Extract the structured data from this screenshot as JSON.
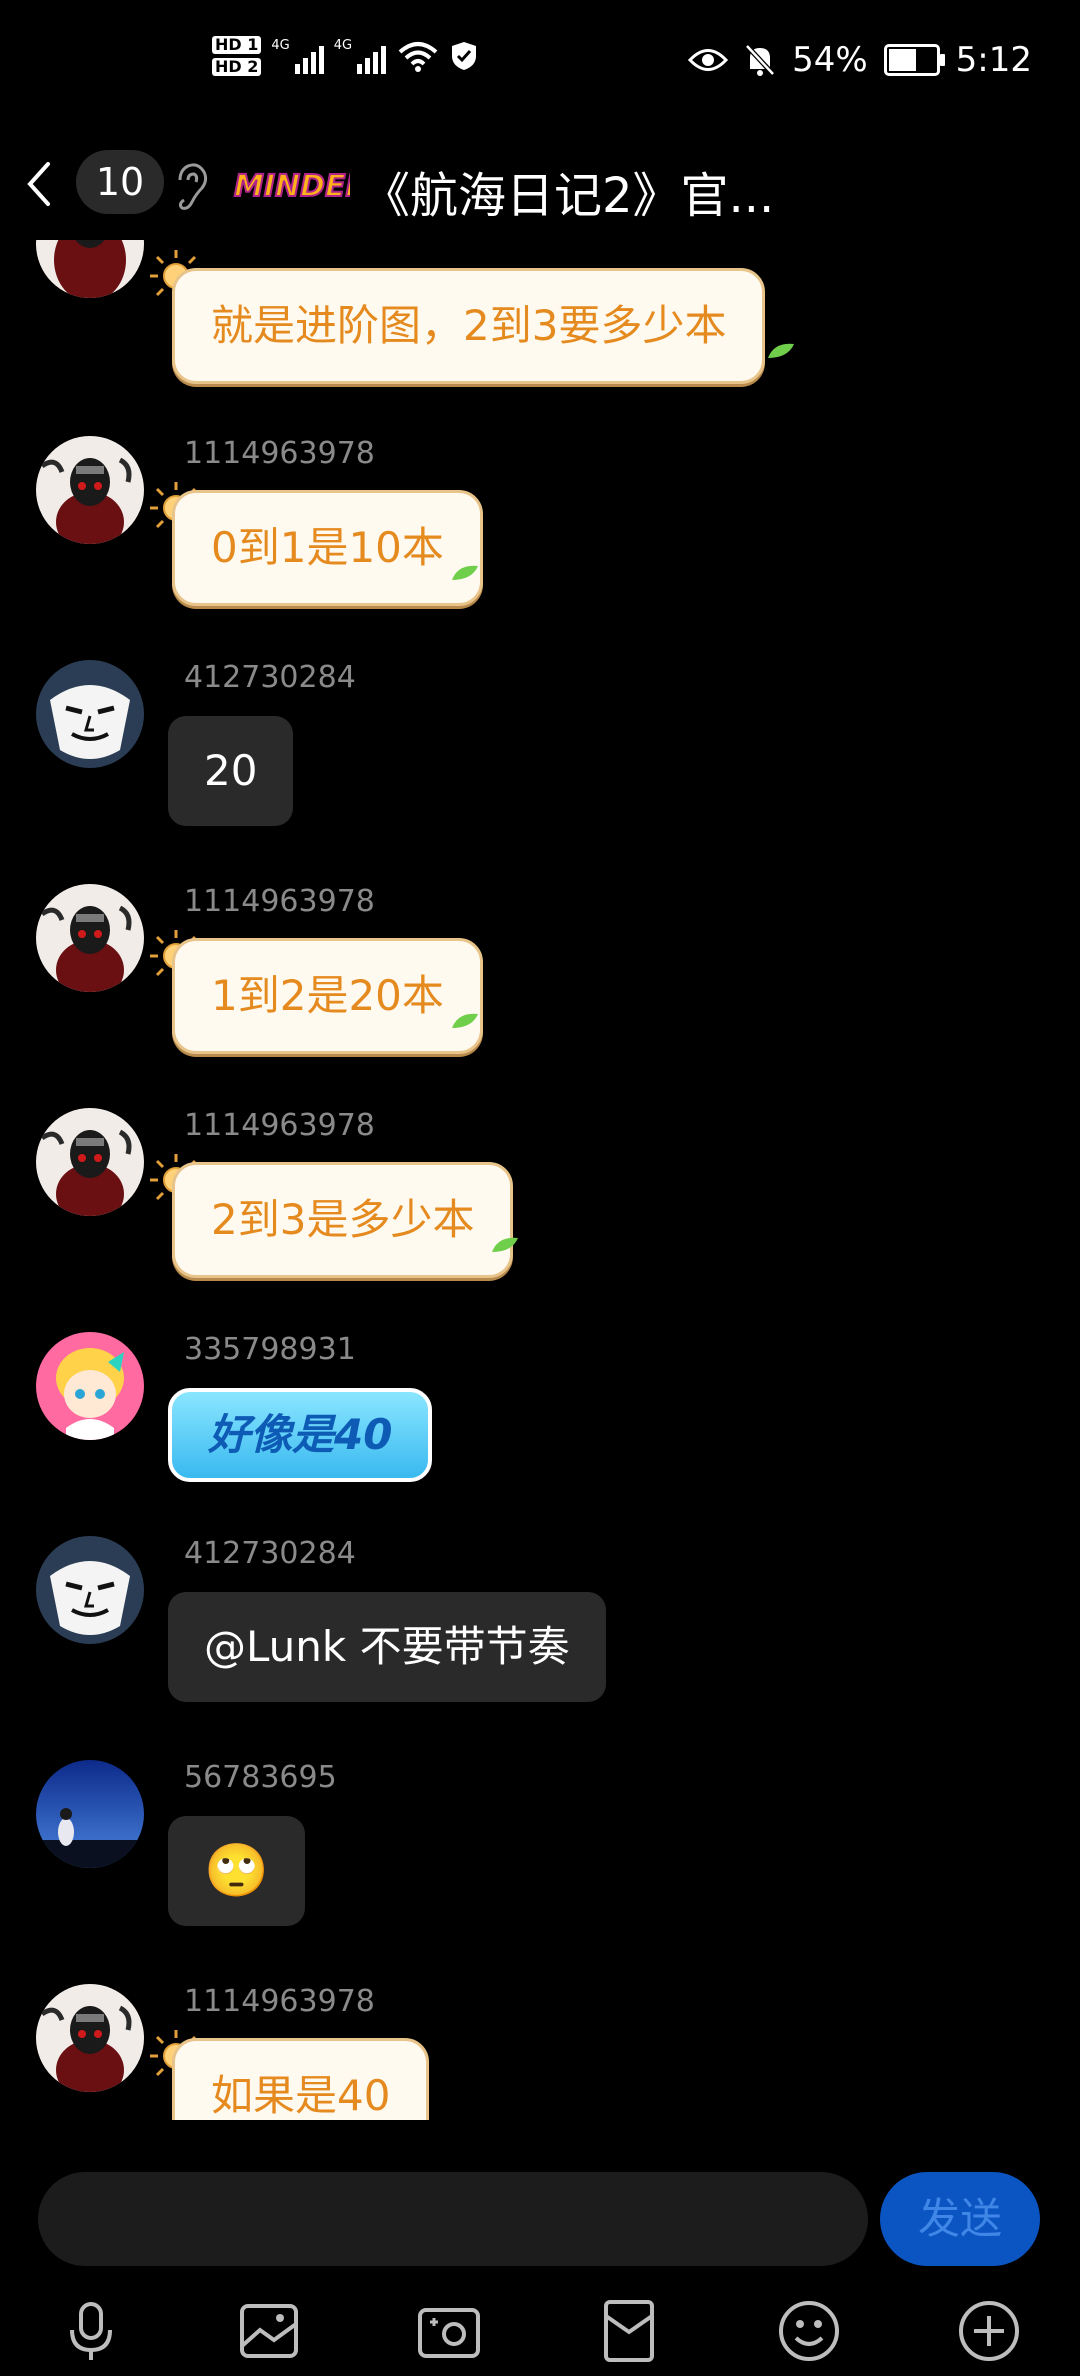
{
  "status_bar": {
    "hd1": "HD 1",
    "hd2": "HD 2",
    "net1": "4G",
    "net2": "4G",
    "wifi_gen": "6",
    "battery": "54%",
    "time": "5:12"
  },
  "header": {
    "unread_count": "10",
    "logo_text": "MINDED",
    "title": "《航海日记2》官..."
  },
  "messages": [
    {
      "sender": "",
      "text": "就是进阶图，2到3要多少本",
      "style": "cream"
    },
    {
      "sender": "1114963978",
      "text": "0到1是10本",
      "style": "cream"
    },
    {
      "sender": "412730284",
      "text": "20",
      "style": "dark"
    },
    {
      "sender": "1114963978",
      "text": "1到2是20本",
      "style": "cream"
    },
    {
      "sender": "1114963978",
      "text": "2到3是多少本",
      "style": "cream"
    },
    {
      "sender": "335798931",
      "text": "好像是40",
      "style": "blue"
    },
    {
      "sender": "412730284",
      "text": "@Lunk 不要带节奏",
      "style": "dark"
    },
    {
      "sender": "56783695",
      "text": "🙄",
      "style": "dark"
    },
    {
      "sender": "1114963978",
      "text": "如果是40",
      "style": "cream"
    }
  ],
  "input": {
    "placeholder": "",
    "send_label": "发送"
  },
  "toolbar": {
    "icons": [
      "microphone-icon",
      "image-icon",
      "camera-icon",
      "red-packet-icon",
      "emoji-icon",
      "plus-icon"
    ]
  },
  "colors": {
    "background": "#000000",
    "cream_text": "#e58a1f",
    "send_button": "#0a55c2"
  }
}
